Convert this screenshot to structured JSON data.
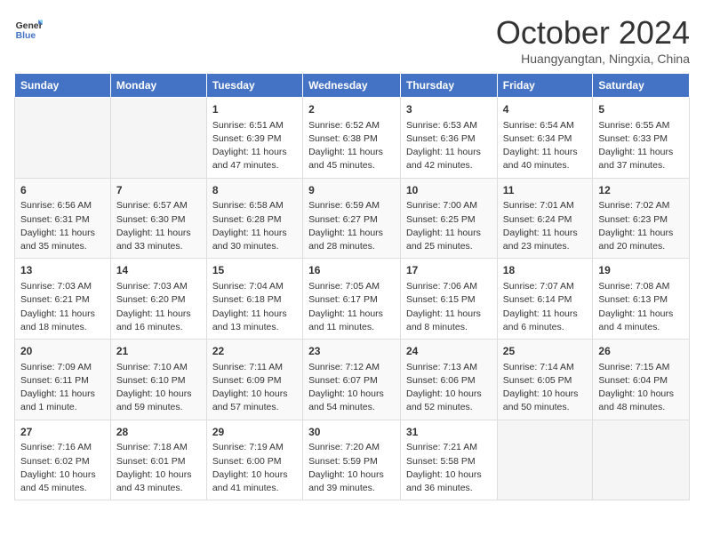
{
  "logo": {
    "line1": "General",
    "line2": "Blue"
  },
  "title": "October 2024",
  "subtitle": "Huangyangtan, Ningxia, China",
  "days_header": [
    "Sunday",
    "Monday",
    "Tuesday",
    "Wednesday",
    "Thursday",
    "Friday",
    "Saturday"
  ],
  "weeks": [
    [
      {
        "day": "",
        "text": ""
      },
      {
        "day": "",
        "text": ""
      },
      {
        "day": "1",
        "text": "Sunrise: 6:51 AM\nSunset: 6:39 PM\nDaylight: 11 hours and 47 minutes."
      },
      {
        "day": "2",
        "text": "Sunrise: 6:52 AM\nSunset: 6:38 PM\nDaylight: 11 hours and 45 minutes."
      },
      {
        "day": "3",
        "text": "Sunrise: 6:53 AM\nSunset: 6:36 PM\nDaylight: 11 hours and 42 minutes."
      },
      {
        "day": "4",
        "text": "Sunrise: 6:54 AM\nSunset: 6:34 PM\nDaylight: 11 hours and 40 minutes."
      },
      {
        "day": "5",
        "text": "Sunrise: 6:55 AM\nSunset: 6:33 PM\nDaylight: 11 hours and 37 minutes."
      }
    ],
    [
      {
        "day": "6",
        "text": "Sunrise: 6:56 AM\nSunset: 6:31 PM\nDaylight: 11 hours and 35 minutes."
      },
      {
        "day": "7",
        "text": "Sunrise: 6:57 AM\nSunset: 6:30 PM\nDaylight: 11 hours and 33 minutes."
      },
      {
        "day": "8",
        "text": "Sunrise: 6:58 AM\nSunset: 6:28 PM\nDaylight: 11 hours and 30 minutes."
      },
      {
        "day": "9",
        "text": "Sunrise: 6:59 AM\nSunset: 6:27 PM\nDaylight: 11 hours and 28 minutes."
      },
      {
        "day": "10",
        "text": "Sunrise: 7:00 AM\nSunset: 6:25 PM\nDaylight: 11 hours and 25 minutes."
      },
      {
        "day": "11",
        "text": "Sunrise: 7:01 AM\nSunset: 6:24 PM\nDaylight: 11 hours and 23 minutes."
      },
      {
        "day": "12",
        "text": "Sunrise: 7:02 AM\nSunset: 6:23 PM\nDaylight: 11 hours and 20 minutes."
      }
    ],
    [
      {
        "day": "13",
        "text": "Sunrise: 7:03 AM\nSunset: 6:21 PM\nDaylight: 11 hours and 18 minutes."
      },
      {
        "day": "14",
        "text": "Sunrise: 7:03 AM\nSunset: 6:20 PM\nDaylight: 11 hours and 16 minutes."
      },
      {
        "day": "15",
        "text": "Sunrise: 7:04 AM\nSunset: 6:18 PM\nDaylight: 11 hours and 13 minutes."
      },
      {
        "day": "16",
        "text": "Sunrise: 7:05 AM\nSunset: 6:17 PM\nDaylight: 11 hours and 11 minutes."
      },
      {
        "day": "17",
        "text": "Sunrise: 7:06 AM\nSunset: 6:15 PM\nDaylight: 11 hours and 8 minutes."
      },
      {
        "day": "18",
        "text": "Sunrise: 7:07 AM\nSunset: 6:14 PM\nDaylight: 11 hours and 6 minutes."
      },
      {
        "day": "19",
        "text": "Sunrise: 7:08 AM\nSunset: 6:13 PM\nDaylight: 11 hours and 4 minutes."
      }
    ],
    [
      {
        "day": "20",
        "text": "Sunrise: 7:09 AM\nSunset: 6:11 PM\nDaylight: 11 hours and 1 minute."
      },
      {
        "day": "21",
        "text": "Sunrise: 7:10 AM\nSunset: 6:10 PM\nDaylight: 10 hours and 59 minutes."
      },
      {
        "day": "22",
        "text": "Sunrise: 7:11 AM\nSunset: 6:09 PM\nDaylight: 10 hours and 57 minutes."
      },
      {
        "day": "23",
        "text": "Sunrise: 7:12 AM\nSunset: 6:07 PM\nDaylight: 10 hours and 54 minutes."
      },
      {
        "day": "24",
        "text": "Sunrise: 7:13 AM\nSunset: 6:06 PM\nDaylight: 10 hours and 52 minutes."
      },
      {
        "day": "25",
        "text": "Sunrise: 7:14 AM\nSunset: 6:05 PM\nDaylight: 10 hours and 50 minutes."
      },
      {
        "day": "26",
        "text": "Sunrise: 7:15 AM\nSunset: 6:04 PM\nDaylight: 10 hours and 48 minutes."
      }
    ],
    [
      {
        "day": "27",
        "text": "Sunrise: 7:16 AM\nSunset: 6:02 PM\nDaylight: 10 hours and 45 minutes."
      },
      {
        "day": "28",
        "text": "Sunrise: 7:18 AM\nSunset: 6:01 PM\nDaylight: 10 hours and 43 minutes."
      },
      {
        "day": "29",
        "text": "Sunrise: 7:19 AM\nSunset: 6:00 PM\nDaylight: 10 hours and 41 minutes."
      },
      {
        "day": "30",
        "text": "Sunrise: 7:20 AM\nSunset: 5:59 PM\nDaylight: 10 hours and 39 minutes."
      },
      {
        "day": "31",
        "text": "Sunrise: 7:21 AM\nSunset: 5:58 PM\nDaylight: 10 hours and 36 minutes."
      },
      {
        "day": "",
        "text": ""
      },
      {
        "day": "",
        "text": ""
      }
    ]
  ]
}
